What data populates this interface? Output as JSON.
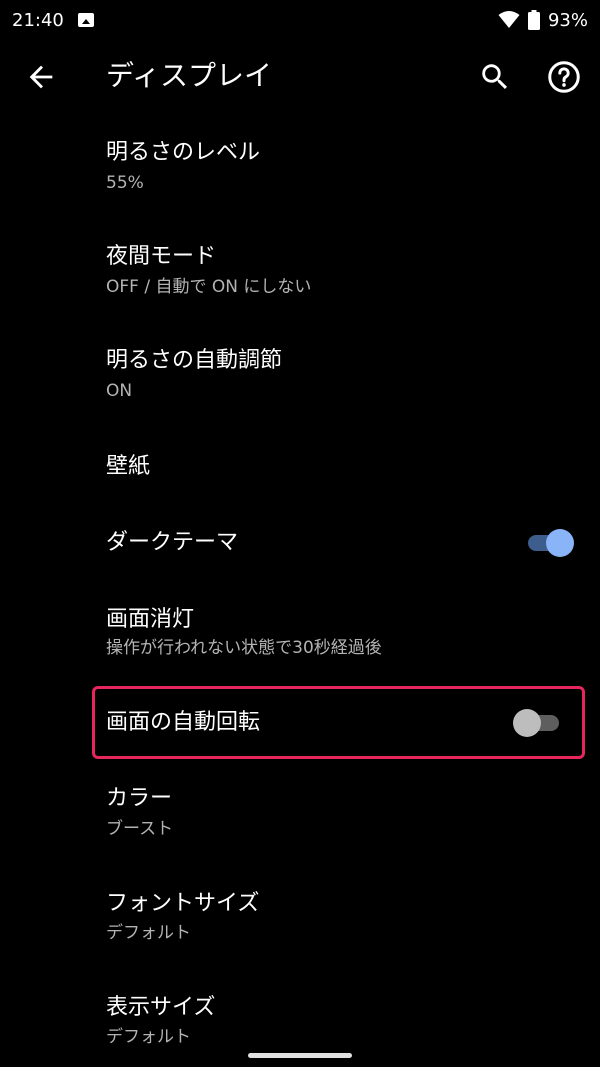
{
  "status": {
    "time": "21:40",
    "battery": "93%"
  },
  "appbar": {
    "title": "ディスプレイ"
  },
  "settings": [
    {
      "title": "明るさのレベル",
      "subtitle": "55%"
    },
    {
      "title": "夜間モード",
      "subtitle": "OFF / 自動で ON にしない"
    },
    {
      "title": "明るさの自動調節",
      "subtitle": "ON"
    },
    {
      "title": "壁紙"
    },
    {
      "title": "ダークテーマ",
      "toggle": true
    },
    {
      "title": "画面消灯",
      "subtitle": "操作が行われない状態で30秒経過後"
    },
    {
      "title": "画面の自動回転",
      "toggle": false
    },
    {
      "title": "カラー",
      "subtitle": "ブースト"
    },
    {
      "title": "フォントサイズ",
      "subtitle": "デフォルト"
    },
    {
      "title": "表示サイズ",
      "subtitle": "デフォルト"
    }
  ],
  "colors": {
    "toggle_on": "#8ab4f8",
    "highlight": "#e8265e",
    "background": "#000000"
  }
}
